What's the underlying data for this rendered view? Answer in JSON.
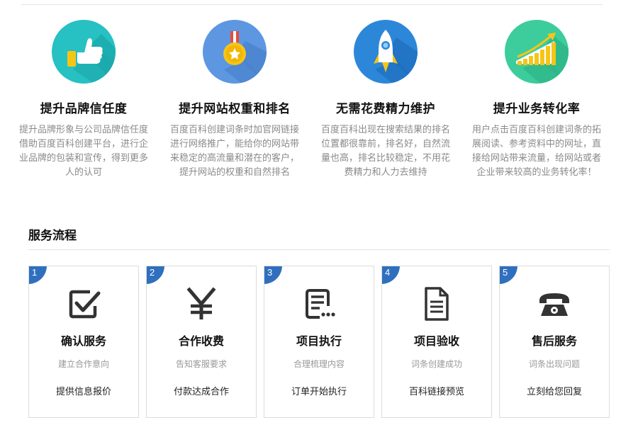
{
  "features": [
    {
      "title": "提升品牌信任度",
      "description": "提升品牌形象与公司品牌信任度借助百度百科创建平台，进行企业品牌的包装和宣传，得到更多人的认可",
      "icon": "thumbs-up-icon",
      "color": "#27c0c3"
    },
    {
      "title": "提升网站权重和排名",
      "description": "百度百科创建词条时加官网链接进行网络推广，能给你的网站带来稳定的高流量和潜在的客户，提升网站的权重和自然排名",
      "icon": "medal-icon",
      "color": "#5d97e2"
    },
    {
      "title": "无需花费精力维护",
      "description": "百度百科出现在搜索结果的排名位置都很靠前，排名好，自然流量也高，排名比较稳定，不用花费精力和人力去维持",
      "icon": "rocket-icon",
      "color": "#2d87d8"
    },
    {
      "title": "提升业务转化率",
      "description": "用户点击百度百科创建词条的拓展阅读、参考资料中的网址，直接给网站带来流量，给网站或者企业带来较高的业务转化率！",
      "icon": "growth-chart-icon",
      "color": "#3dcc9c"
    }
  ],
  "process": {
    "title": "服务流程",
    "accent_color": "#2f6fbe",
    "steps": [
      {
        "number": "1",
        "title": "确认服务",
        "subtitle": "建立合作意向",
        "action": "提供信息报价",
        "icon": "checkbox-icon"
      },
      {
        "number": "2",
        "title": "合作收费",
        "subtitle": "告知客服要求",
        "action": "付款达成合作",
        "icon": "yen-icon"
      },
      {
        "number": "3",
        "title": "项目执行",
        "subtitle": "合理梳理内容",
        "action": "订单开始执行",
        "icon": "list-document-icon"
      },
      {
        "number": "4",
        "title": "项目验收",
        "subtitle": "词条创建成功",
        "action": "百科链接预览",
        "icon": "document-icon"
      },
      {
        "number": "5",
        "title": "售后服务",
        "subtitle": "词条出现问题",
        "action": "立刻给您回复",
        "icon": "telephone-icon"
      }
    ]
  }
}
